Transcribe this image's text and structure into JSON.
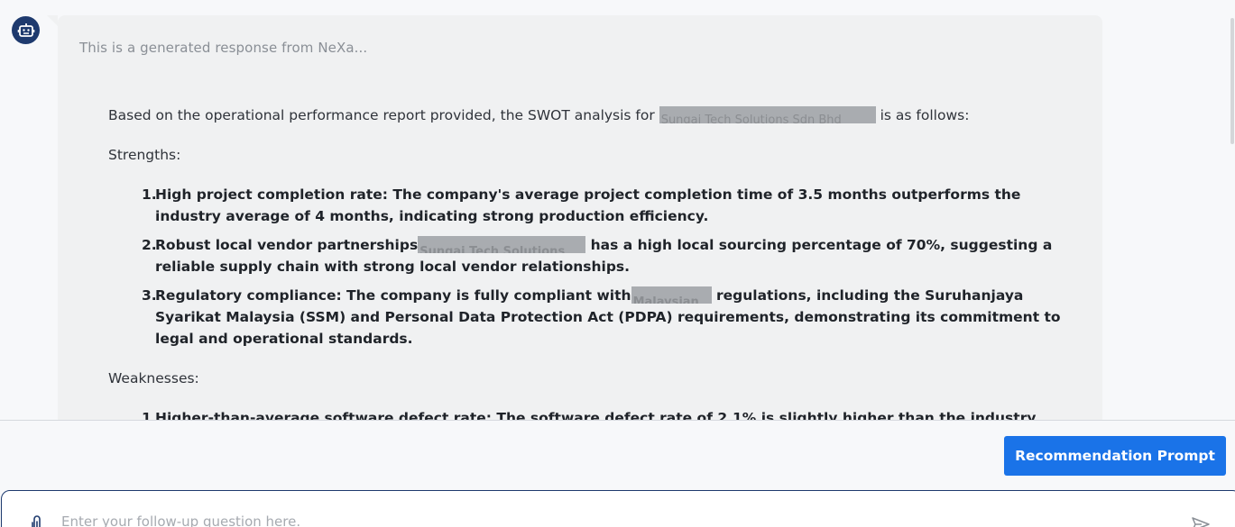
{
  "message": {
    "generated_note": "This is a generated response from NeXa...",
    "intro_before": "Based on the operational performance report provided, the SWOT analysis for",
    "intro_redacted": "Sungai Tech Solutions Sdn Bhd",
    "intro_after": "is as follows:",
    "strengths_heading": "Strengths:",
    "strengths": [
      {
        "num": "1.",
        "text": "High project completion rate: The company's average project completion time of 3.5 months outperforms the industry average of 4 months, indicating strong production efficiency."
      },
      {
        "num": "2.",
        "before": "Robust local vendor partnerships",
        "redacted": "Sungai Tech Solutions",
        "after": "has a high local sourcing percentage of 70%, suggesting a reliable supply chain with strong local vendor relationships."
      },
      {
        "num": "3.",
        "before": "Regulatory compliance: The company is fully compliant with",
        "redacted": "Malaysian",
        "after": "regulations, including the Suruhanjaya Syarikat Malaysia (SSM) and Personal Data Protection Act (PDPA) requirements, demonstrating its commitment to legal and operational standards."
      }
    ],
    "weaknesses_heading": "Weaknesses:",
    "weaknesses": [
      {
        "num": "1.",
        "text": "Higher-than-average software defect rate: The software defect rate of 2.1% is slightly higher than the industry"
      }
    ]
  },
  "actions": {
    "recommendation_label": "Recommendation Prompt"
  },
  "composer": {
    "placeholder": "Enter your follow-up question here."
  },
  "colors": {
    "accent": "#1a73e8",
    "avatar": "#1e3a6e",
    "bubble": "#f0f1f2"
  },
  "icons": {
    "avatar": "robot-icon",
    "attach": "paperclip-icon",
    "send": "send-icon"
  }
}
